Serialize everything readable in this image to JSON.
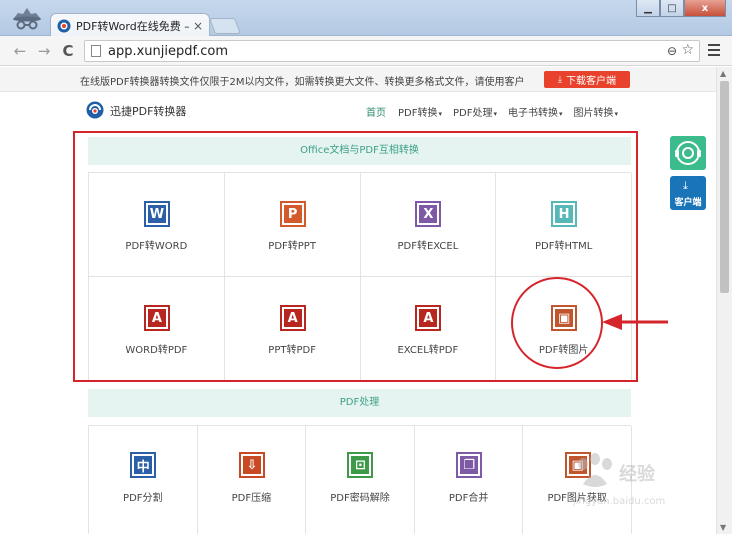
{
  "browser": {
    "tab_title": "PDF转Word在线免费 – 在",
    "tab_close": "×",
    "url": "app.xunjiepdf.com",
    "back": "←",
    "forward": "→",
    "reload": "C",
    "zoom": "⊖",
    "star": "☆",
    "min": "▁",
    "max": "□",
    "close": "x"
  },
  "notice": {
    "text": "在线版PDF转换器转换文件仅限于2M以内文件，如需转换更大文件、转换更多格式文件，请使用客户",
    "download_label": "下载客户端",
    "download_icon": "⤓"
  },
  "site": {
    "brand": "迅捷PDF转换器",
    "nav": [
      {
        "label": "首页",
        "caret": ""
      },
      {
        "label": "PDF转换",
        "caret": "▾"
      },
      {
        "label": "PDF处理",
        "caret": "▾"
      },
      {
        "label": "电子书转换",
        "caret": "▾"
      },
      {
        "label": "图片转换",
        "caret": "▾"
      }
    ]
  },
  "office_section": {
    "title": "Office文档与PDF互相转换",
    "items": [
      {
        "label": "PDF转WORD",
        "letter": "W",
        "color": "#2b5fa8"
      },
      {
        "label": "PDF转PPT",
        "letter": "P",
        "color": "#d35a2d"
      },
      {
        "label": "PDF转EXCEL",
        "letter": "X",
        "color": "#7e5aa6"
      },
      {
        "label": "PDF转HTML",
        "letter": "H",
        "color": "#57b9b7"
      },
      {
        "label": "WORD转PDF",
        "letter": "A",
        "color": "#b8271f"
      },
      {
        "label": "PPT转PDF",
        "letter": "A",
        "color": "#b8271f"
      },
      {
        "label": "EXCEL转PDF",
        "letter": "A",
        "color": "#b8271f"
      },
      {
        "label": "PDF转图片",
        "letter": "▣",
        "color": "#c0562d"
      }
    ]
  },
  "pdf_section": {
    "title": "PDF处理",
    "items": [
      {
        "label": "PDF分割",
        "letter": "中",
        "color": "#2b5fa8"
      },
      {
        "label": "PDF压缩",
        "letter": "⇩",
        "color": "#c84a24"
      },
      {
        "label": "PDF密码解除",
        "letter": "⊡",
        "color": "#3d9a48"
      },
      {
        "label": "PDF合并",
        "letter": "❐",
        "color": "#7e5aa6"
      },
      {
        "label": "PDF图片获取",
        "letter": "▣",
        "color": "#c0562d"
      }
    ]
  },
  "float": {
    "client_label": "客户端",
    "client_icon": "⤓"
  },
  "watermark": {
    "text": "经验",
    "url": "jingyan.baidu.com"
  },
  "colors": {
    "accent_green": "#3c9f86",
    "highlight_red": "#d6242b",
    "download_red": "#e8412c"
  }
}
